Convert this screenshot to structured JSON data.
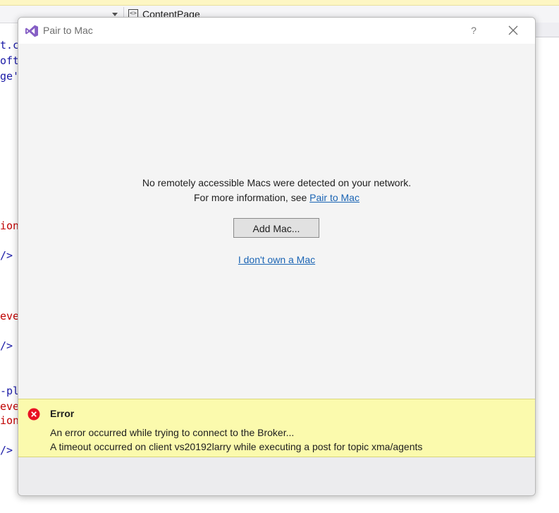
{
  "background": {
    "class_selector": "ContentPage",
    "code_fragments": [
      {
        "text": "t.c",
        "color": "blue"
      },
      {
        "text": "oft",
        "color": "blue"
      },
      {
        "text": "ge'",
        "color": "blue"
      },
      {
        "text": "ion",
        "color": "red"
      },
      {
        "text": "/>",
        "color": "blue"
      },
      {
        "text": "eve",
        "color": "red"
      },
      {
        "text": "/>",
        "color": "blue"
      },
      {
        "text": "-pl",
        "color": "blue"
      },
      {
        "text": "eve",
        "color": "red"
      },
      {
        "text": "ion",
        "color": "red"
      },
      {
        "text": "/>",
        "color": "blue"
      }
    ]
  },
  "dialog": {
    "title": "Pair to Mac",
    "help_label": "?",
    "message_line1": "No remotely accessible Macs were detected on your network.",
    "message_line2_prefix": "For more information, see ",
    "message_link": "Pair to Mac",
    "add_button": "Add Mac...",
    "no_mac_link": "I don't own a Mac"
  },
  "error": {
    "title": "Error",
    "message1": "An error occurred while trying to connect to the Broker...",
    "message2": "A timeout occurred on client vs20192larry while executing a post for topic xma/agents"
  },
  "colors": {
    "dialog_bg": "#f4f4f4",
    "link": "#1a64b4",
    "error_banner": "#fbfaad",
    "error_icon": "#e81123",
    "vs_purple": "#865fc5"
  }
}
